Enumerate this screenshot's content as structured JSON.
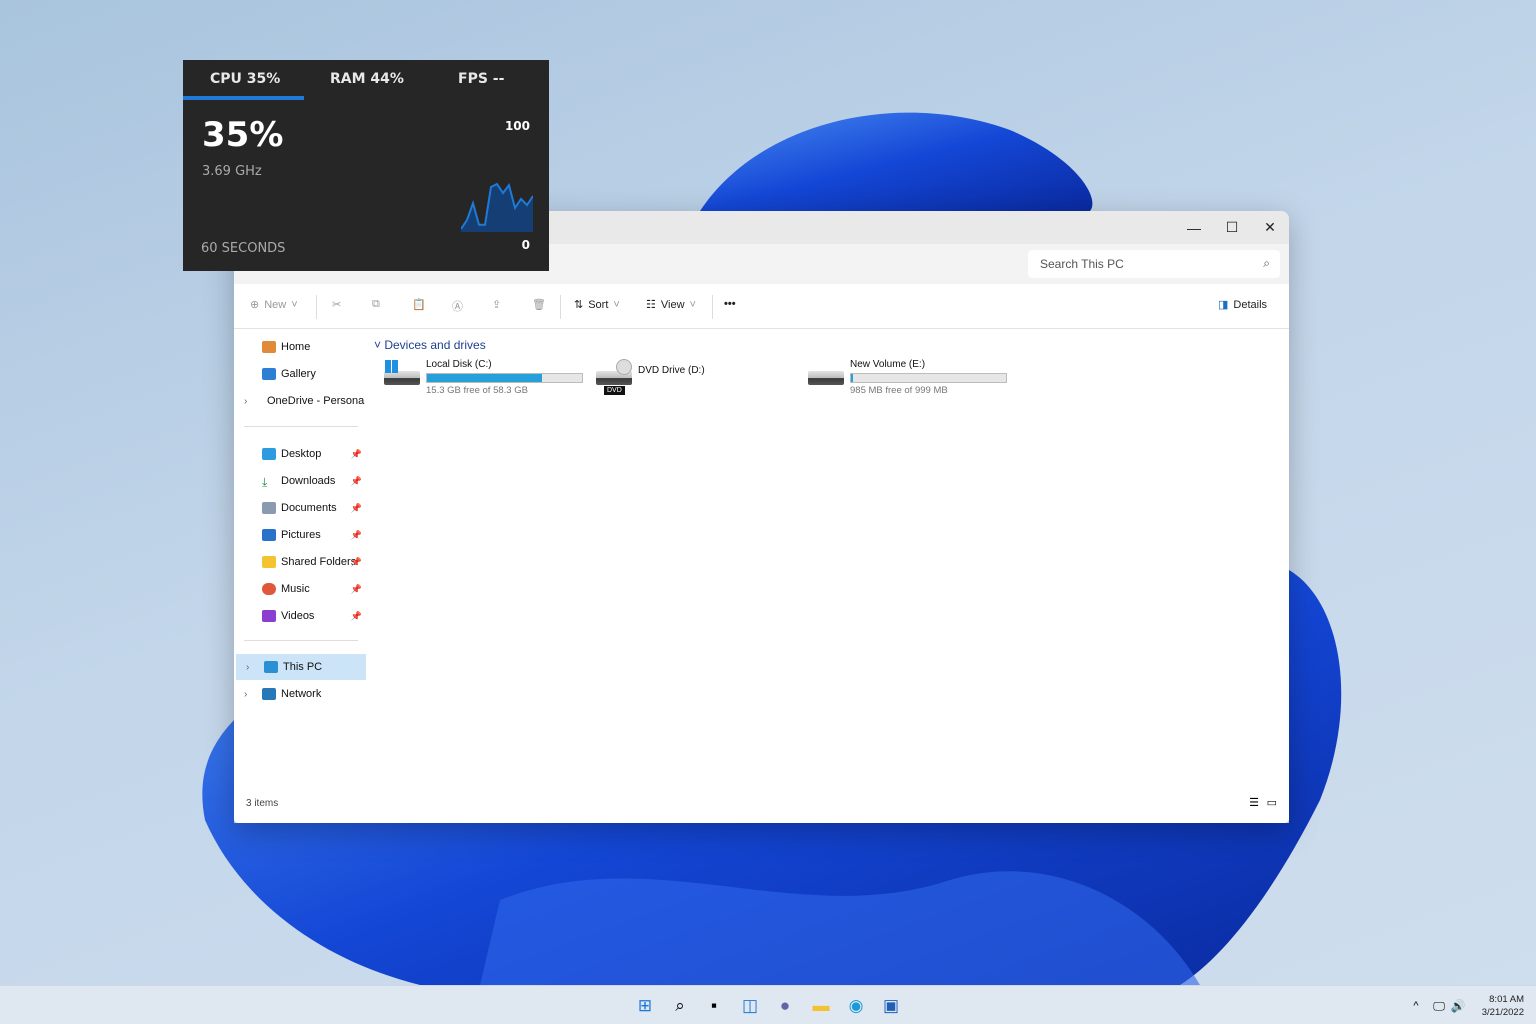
{
  "overlay": {
    "tabs": [
      {
        "label": "CPU  35%",
        "active": true
      },
      {
        "label": "RAM  44%"
      },
      {
        "label": "FPS  --"
      }
    ],
    "big_value": "35%",
    "freq": "3.69 GHz",
    "max_label": "100",
    "min_label": "0",
    "duration": "60 SECONDS",
    "accent": "#1e7ad6",
    "cpu_history": [
      5,
      20,
      48,
      12,
      12,
      75,
      80,
      65,
      78,
      40,
      55,
      45,
      60
    ]
  },
  "explorer": {
    "search_placeholder": "Search This PC",
    "toolbar": {
      "new": "New",
      "sort": "Sort",
      "view": "View",
      "more": "•••",
      "details": "Details"
    },
    "sidebar": [
      {
        "label": "Home"
      },
      {
        "label": "Gallery"
      },
      {
        "label": "OneDrive - Persona"
      },
      {
        "label": "Desktop"
      },
      {
        "label": "Downloads"
      },
      {
        "label": "Documents"
      },
      {
        "label": "Pictures"
      },
      {
        "label": "Shared Folders"
      },
      {
        "label": "Music"
      },
      {
        "label": "Videos"
      },
      {
        "label": "This PC"
      },
      {
        "label": "Network"
      }
    ],
    "section": "Devices and drives",
    "drives": [
      {
        "name": "Local Disk (C:)",
        "free": "15.3 GB free of 58.3 GB",
        "used_fraction": 0.74
      },
      {
        "name": "DVD Drive (D:)",
        "badge": "DVD"
      },
      {
        "name": "New Volume (E:)",
        "free": "985 MB free of 999 MB",
        "used_fraction": 0.014
      }
    ],
    "status": "3 items"
  },
  "taskbar": {
    "time": "8:01 AM",
    "date": "3/21/2022"
  }
}
